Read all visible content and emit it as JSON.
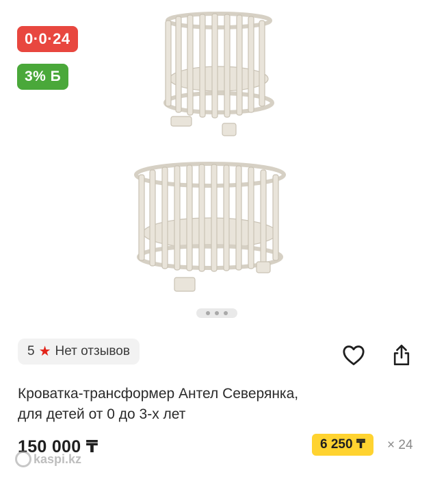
{
  "badges": {
    "installment": "0·0·24",
    "bonus": "3% Б"
  },
  "rating": {
    "score": "5",
    "reviews_label": "Нет отзывов"
  },
  "product": {
    "title_line1": "Кроватка-трансформер Антел Северянка,",
    "title_line2": "для детей от 0 до 3-х лет"
  },
  "pricing": {
    "price": "150 000 ₸",
    "monthly": "6 250 ₸",
    "months": "× 24"
  },
  "watermark": "kaspi.kz",
  "gallery": {
    "image_count": 3,
    "active_index": 0
  },
  "icons": {
    "star": "star-icon",
    "favorite": "heart-icon",
    "share": "share-icon"
  },
  "colors": {
    "installment": "#e8473f",
    "bonus": "#4aa83a",
    "monthly": "#ffd330",
    "star": "#e2241a"
  }
}
